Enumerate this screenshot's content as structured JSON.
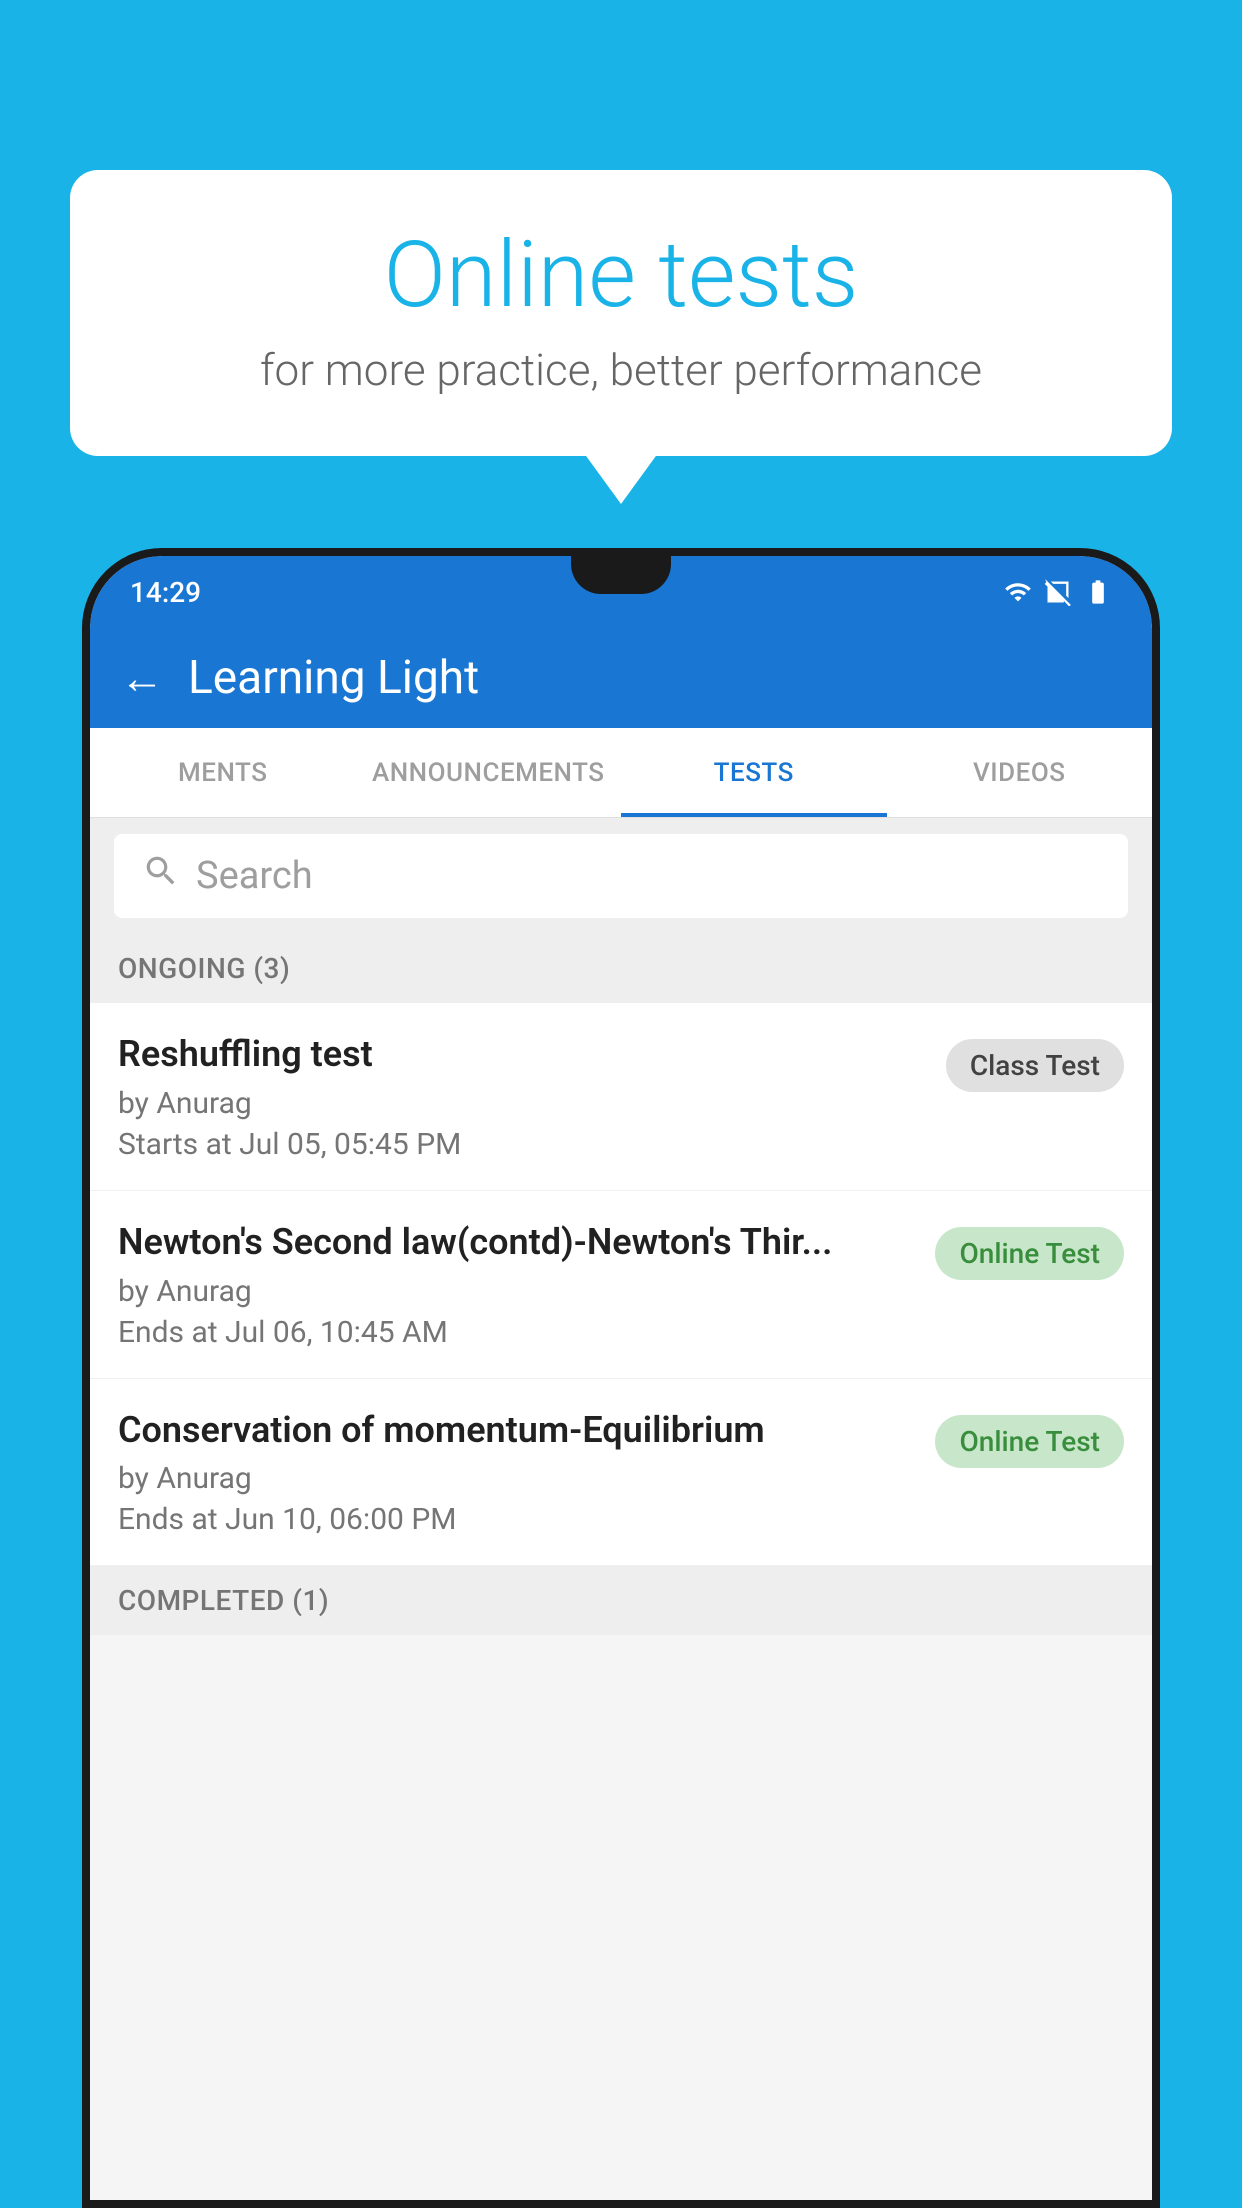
{
  "background": {
    "color": "#1ab3e8"
  },
  "bubble": {
    "title": "Online tests",
    "subtitle": "for more practice, better performance"
  },
  "status_bar": {
    "time": "14:29",
    "wifi_icon": "wifi-icon",
    "signal_icon": "signal-icon",
    "battery_icon": "battery-icon"
  },
  "app_bar": {
    "back_label": "←",
    "title": "Learning Light"
  },
  "tabs": [
    {
      "label": "MENTS",
      "active": false
    },
    {
      "label": "ANNOUNCEMENTS",
      "active": false
    },
    {
      "label": "TESTS",
      "active": true
    },
    {
      "label": "VIDEOS",
      "active": false
    }
  ],
  "search": {
    "placeholder": "Search"
  },
  "ongoing_section": {
    "label": "ONGOING (3)"
  },
  "tests": [
    {
      "name": "Reshuffling test",
      "author": "by Anurag",
      "date_label": "Starts at  Jul 05, 05:45 PM",
      "badge": "Class Test",
      "badge_type": "class"
    },
    {
      "name": "Newton's Second law(contd)-Newton's Thir...",
      "author": "by Anurag",
      "date_label": "Ends at  Jul 06, 10:45 AM",
      "badge": "Online Test",
      "badge_type": "online"
    },
    {
      "name": "Conservation of momentum-Equilibrium",
      "author": "by Anurag",
      "date_label": "Ends at  Jun 10, 06:00 PM",
      "badge": "Online Test",
      "badge_type": "online"
    }
  ],
  "completed_section": {
    "label": "COMPLETED (1)"
  }
}
